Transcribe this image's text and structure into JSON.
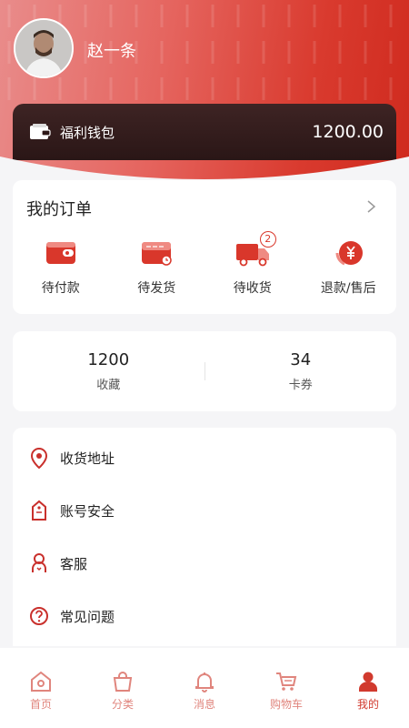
{
  "profile": {
    "username": "赵一条",
    "avatar_icon": "user-avatar"
  },
  "wallet": {
    "label": "福利钱包",
    "amount": "1200.00",
    "icon": "wallet-icon"
  },
  "orders": {
    "title": "我的订单",
    "items": [
      {
        "label": "待付款",
        "icon": "wallet-red-icon"
      },
      {
        "label": "待发货",
        "icon": "card-clock-icon"
      },
      {
        "label": "待收货",
        "icon": "truck-icon",
        "badge": "2"
      },
      {
        "label": "退款/售后",
        "icon": "yen-coin-icon"
      }
    ]
  },
  "stats": [
    {
      "value": "1200",
      "label": "收藏"
    },
    {
      "value": "34",
      "label": "卡券"
    }
  ],
  "menu": [
    {
      "label": "收货地址",
      "icon": "location-pin-icon"
    },
    {
      "label": "账号安全",
      "icon": "shield-tag-icon"
    },
    {
      "label": "客服",
      "icon": "customer-service-icon"
    },
    {
      "label": "常见问题",
      "icon": "question-icon"
    }
  ],
  "nav": [
    {
      "label": "首页",
      "icon": "home-icon"
    },
    {
      "label": "分类",
      "icon": "bag-icon"
    },
    {
      "label": "消息",
      "icon": "bell-icon"
    },
    {
      "label": "购物车",
      "icon": "cart-icon"
    },
    {
      "label": "我的",
      "icon": "person-icon",
      "active": true
    }
  ],
  "colors": {
    "primary": "#d9372b",
    "header_light": "#e98c8b",
    "wallet_bg": "#2e1818",
    "nav_inactive": "#e0857d"
  }
}
